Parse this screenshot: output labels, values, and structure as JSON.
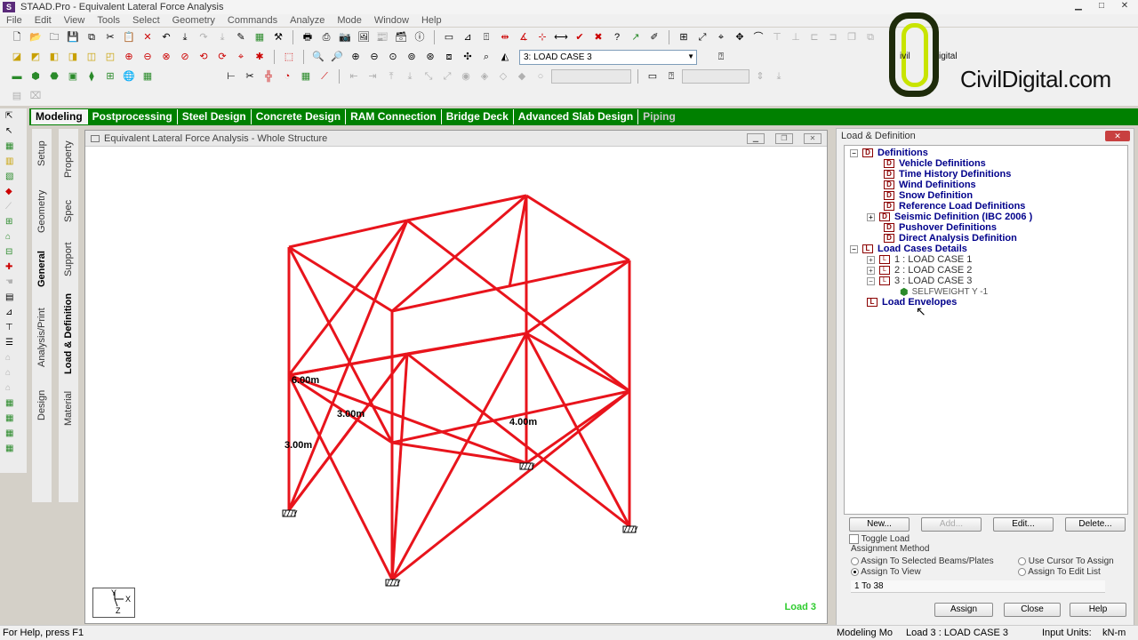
{
  "window": {
    "title": "STAAD.Pro - Equivalent Lateral Force Analysis",
    "app_icon": "staad-icon"
  },
  "menu": [
    "File",
    "Edit",
    "View",
    "Tools",
    "Select",
    "Geometry",
    "Commands",
    "Analyze",
    "Mode",
    "Window",
    "Help"
  ],
  "toolbar": {
    "load_case_select": "3: LOAD CASE 3"
  },
  "logo": {
    "text": "CivilDigital.com",
    "badge_left": "ivil",
    "badge_right": "igital"
  },
  "tabs": [
    "Modeling",
    "Postprocessing",
    "Steel Design",
    "Concrete Design",
    "RAM Connection",
    "Bridge Deck",
    "Advanced Slab Design",
    "Piping"
  ],
  "active_tab": "Modeling",
  "side_tabs_left": [
    "Setup",
    "Geometry",
    "General",
    "Analysis/Print",
    "Design"
  ],
  "side_tabs_right": [
    "Property",
    "Spec",
    "Support",
    "Load & Definition",
    "Material"
  ],
  "viewport": {
    "title": "Equivalent Lateral Force Analysis - Whole Structure",
    "dimensions": [
      "6.00m",
      "3.00m",
      "3.00m",
      "4.00m"
    ],
    "load_label": "Load 3",
    "axis": {
      "y": "Y",
      "x": "X",
      "z": "Z"
    },
    "member_color": "#e8141c"
  },
  "panel": {
    "title": "Load & Definition",
    "tree": {
      "definitions": "Definitions",
      "definition_items": [
        "Vehicle Definitions",
        "Time History Definitions",
        "Wind Definitions",
        "Snow Definition",
        "Reference Load Definitions",
        "Seismic Definition (IBC 2006 )",
        "Pushover Definitions",
        "Direct Analysis Definition"
      ],
      "load_cases_details": "Load Cases Details",
      "load_cases": [
        "1 : LOAD CASE 1",
        "2 : LOAD CASE 2",
        "3 : LOAD CASE 3"
      ],
      "selfweight": "SELFWEIGHT Y -1",
      "load_envelopes": "Load Envelopes"
    },
    "buttons": {
      "new": "New...",
      "add": "Add...",
      "edit": "Edit...",
      "delete": "Delete..."
    },
    "toggle_load": "Toggle Load",
    "assignment_method": "Assignment Method",
    "options": {
      "selected_beams": "Assign To Selected Beams/Plates",
      "cursor": "Use Cursor To Assign",
      "view": "Assign To View",
      "edit_list": "Assign To Edit List"
    },
    "range_value": "1 To 38",
    "actions": {
      "assign": "Assign",
      "close": "Close",
      "help": "Help"
    }
  },
  "status": {
    "help": "For Help, press F1",
    "mode": "Modeling Mo",
    "load": "Load 3 : LOAD CASE 3",
    "units_label": "Input Units:",
    "units": "kN-m"
  }
}
